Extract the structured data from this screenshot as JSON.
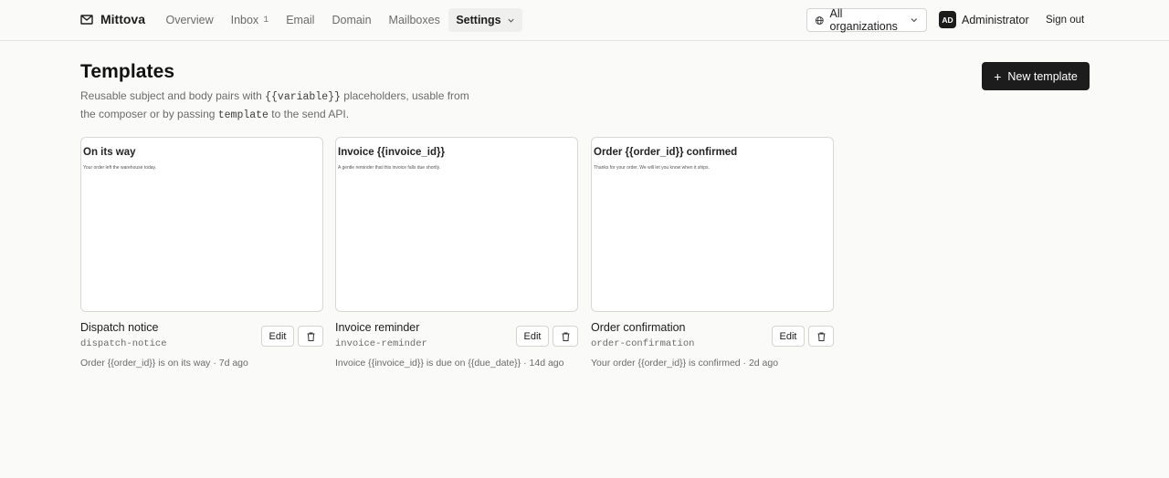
{
  "brand": {
    "name": "Mittova",
    "icon": "mail-icon"
  },
  "nav": {
    "overview": "Overview",
    "inbox": "Inbox",
    "inbox_count": "1",
    "email": "Email",
    "domain": "Domain",
    "mailboxes": "Mailboxes",
    "settings": "Settings"
  },
  "org_select": {
    "value": "All organizations",
    "icon": "globe-icon"
  },
  "user": {
    "initials": "AD",
    "name": "Administrator"
  },
  "signout_label": "Sign out",
  "page": {
    "title": "Templates",
    "subtitle_before": "Reusable subject and body pairs with ",
    "subtitle_code1": "{{variable}}",
    "subtitle_mid": " placeholders, usable from the composer or by passing ",
    "subtitle_code2": "template",
    "subtitle_after": " to the send API."
  },
  "new_template_label": "New template",
  "templates": [
    {
      "preview_subject": "On its way",
      "preview_body": "Your order left the warehouse today.",
      "name": "Dispatch notice",
      "slug": "dispatch-notice",
      "meta": "Order {{order_id}} is on its way · 7d ago",
      "edit_label": "Edit"
    },
    {
      "preview_subject": "Invoice {{invoice_id}}",
      "preview_body": "A gentle reminder that this invoice falls due shortly.",
      "name": "Invoice reminder",
      "slug": "invoice-reminder",
      "meta": "Invoice {{invoice_id}} is due on {{due_date}} · 14d ago",
      "edit_label": "Edit"
    },
    {
      "preview_subject": "Order {{order_id}} confirmed",
      "preview_body": "Thanks for your order. We will let you know when it ships.",
      "name": "Order confirmation",
      "slug": "order-confirmation",
      "meta": "Your order {{order_id}} is confirmed · 2d ago",
      "edit_label": "Edit"
    }
  ]
}
